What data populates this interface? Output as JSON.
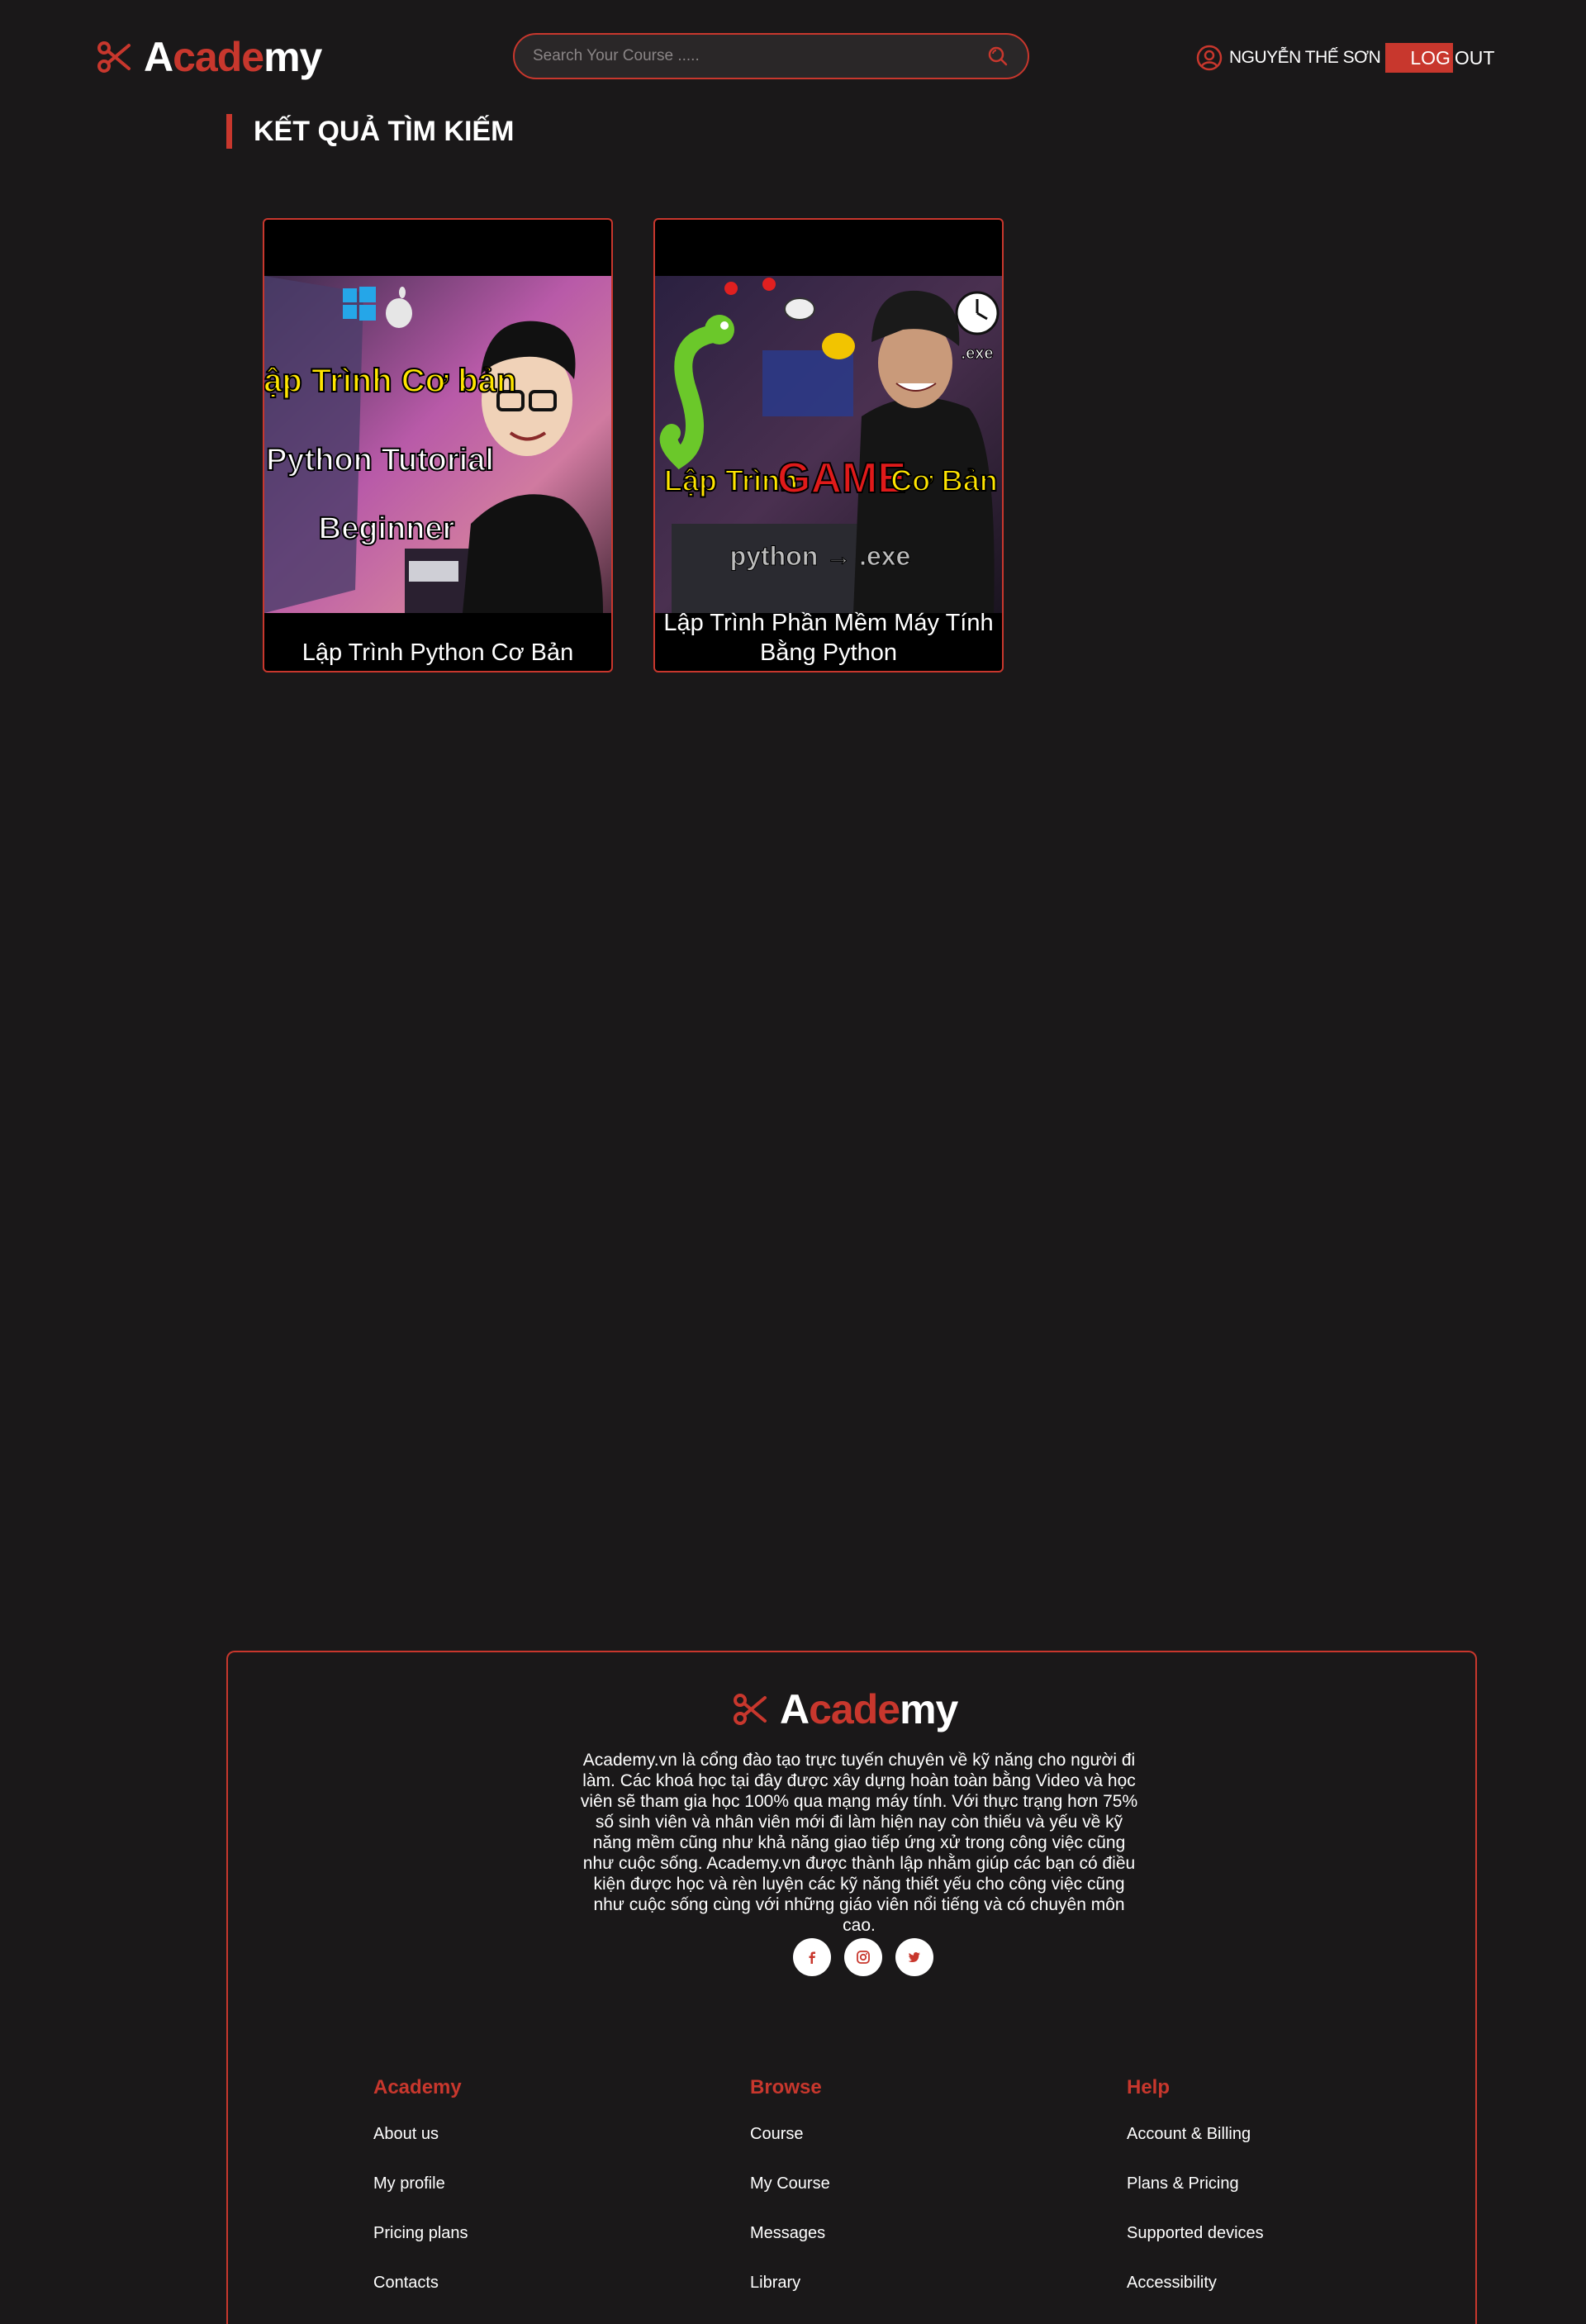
{
  "brand": {
    "part1": "A",
    "part2": "cade",
    "part3": "my",
    "accent_color": "#c8372d",
    "icon": "scissors-icon"
  },
  "header": {
    "search_placeholder": "Search Your Course .....",
    "username": "NGUYỄN THẾ SƠN",
    "logout_part1": "LOG",
    "logout_part2": "OUT"
  },
  "section": {
    "title": "KẾT QUẢ TÌM KIẾM"
  },
  "courses": [
    {
      "title": "Lập Trình Python Cơ Bản",
      "thumb_line1": "Lập Trình Cơ bản",
      "thumb_line2": "Python Tutorial",
      "thumb_line3": "Beginner"
    },
    {
      "title": "Lập Trình Phần Mềm Máy Tính Bằng Python",
      "thumb_line1a": "Lập Trình",
      "thumb_line1b": "GAME",
      "thumb_line1c": "Cơ Bản",
      "thumb_line2": "python → .exe",
      "thumb_badge": ".exe"
    }
  ],
  "footer": {
    "description": "Academy.vn là cổng đào tạo trực tuyến chuyên về kỹ năng cho người đi làm. Các khoá học tại đây được xây dựng hoàn toàn bằng Video và học viên sẽ tham gia học 100% qua mạng máy tính. Với thực trạng hơn 75% số sinh viên và nhân viên mới đi làm hiện nay còn thiếu và yếu về kỹ năng mềm cũng như khả năng giao tiếp ứng xử trong công việc cũng như cuộc sống. Academy.vn được thành lập nhằm giúp các bạn có điều kiện được học và rèn luyện các kỹ năng thiết yếu cho công việc cũng như cuộc sống cùng với những giáo viên nổi tiếng và có chuyên môn cao.",
    "socials": [
      "facebook-icon",
      "instagram-icon",
      "twitter-icon"
    ],
    "columns": [
      {
        "heading": "Academy",
        "links": [
          "About us",
          "My profile",
          "Pricing plans",
          "Contacts"
        ]
      },
      {
        "heading": "Browse",
        "links": [
          "Course",
          "My Course",
          "Messages",
          "Library"
        ]
      },
      {
        "heading": "Help",
        "links": [
          "Account & Billing",
          "Plans & Pricing",
          "Supported devices",
          "Accessibility"
        ]
      }
    ]
  }
}
